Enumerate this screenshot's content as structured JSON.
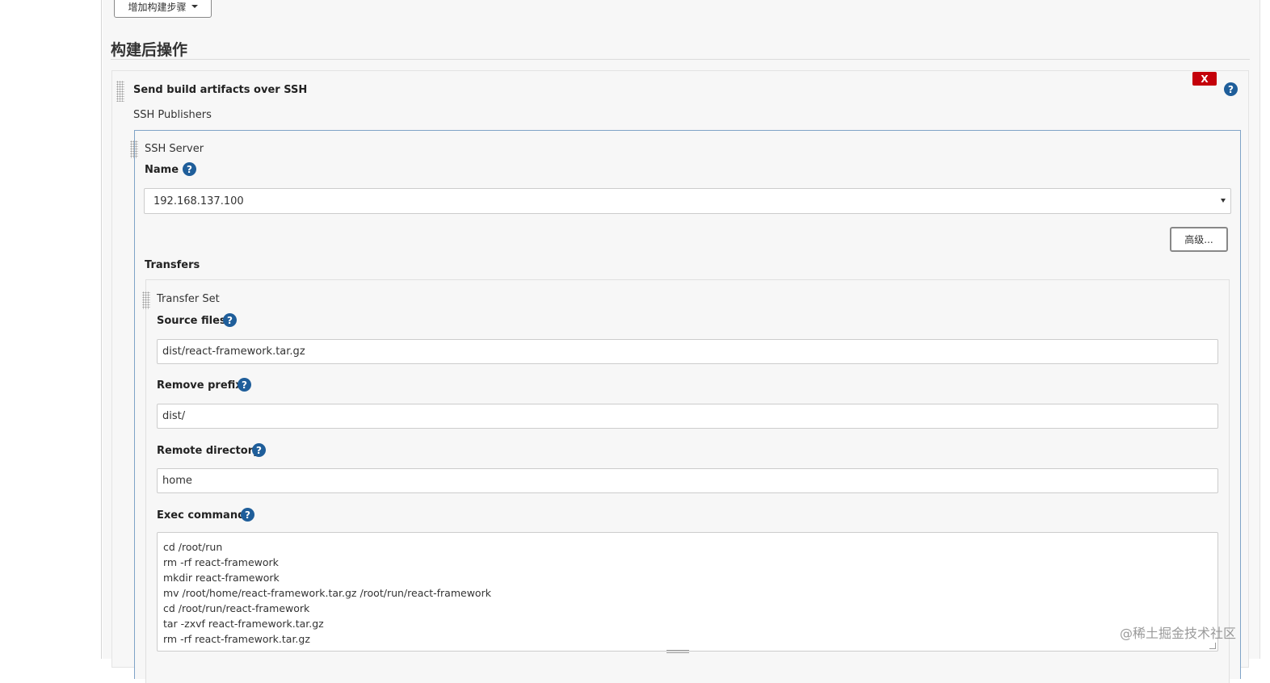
{
  "toolbar": {
    "add_build_step_label": "增加构建步骤"
  },
  "post_build": {
    "title": "构建后操作",
    "step": {
      "title": "Send build artifacts over SSH",
      "delete_label": "X",
      "help": "?",
      "publishers_label": "SSH Publishers",
      "server": {
        "heading": "SSH Server",
        "name_label": "Name",
        "name_value": "192.168.137.100",
        "advanced_label": "高级...",
        "transfers_label": "Transfers",
        "transfer_set": {
          "heading": "Transfer Set",
          "source_files_label": "Source files",
          "source_files_value": "dist/react-framework.tar.gz",
          "remove_prefix_label": "Remove prefix",
          "remove_prefix_value": "dist/",
          "remote_directory_label": "Remote directory",
          "remote_directory_value": "home",
          "exec_command_label": "Exec command",
          "exec_command_lines": [
            "cd /root/run",
            "rm -rf react-framework",
            "mkdir react-framework",
            "mv /root/home/react-framework.tar.gz /root/run/react-framework",
            "cd /root/run/react-framework",
            "tar -zxvf react-framework.tar.gz",
            "rm -rf react-framework.tar.gz"
          ]
        }
      }
    }
  },
  "watermark": "@稀土掘金技术社区",
  "colors": {
    "help_blue": "#1f5e9a",
    "delete_red": "#c4000a",
    "panel_border_blue": "#7fa3c7"
  }
}
